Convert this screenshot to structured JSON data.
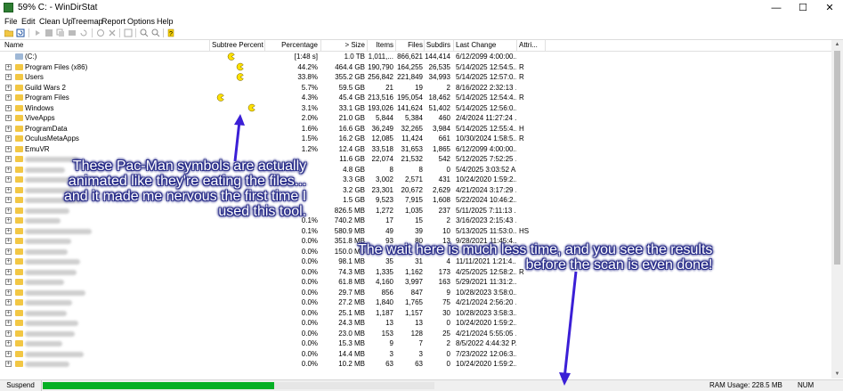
{
  "window": {
    "title": "59% C: - WinDirStat",
    "minimize": "—",
    "maximize": "☐",
    "close": "✕"
  },
  "menu": [
    "File",
    "Edit",
    "Clean Up",
    "Treemap",
    "Report",
    "Options",
    "Help"
  ],
  "columns": {
    "name": "Name",
    "subtree": "Subtree Percent...",
    "percentage": "Percentage",
    "size": "> Size",
    "items": "Items",
    "files": "Files",
    "subdirs": "Subdirs",
    "last_change": "Last Change",
    "attr": "Attri..."
  },
  "rows": [
    {
      "name": "(C:)",
      "pct": "[1:48 s]",
      "size": "1.0 TB",
      "items": "1,011,...",
      "files": "866,621",
      "subdirs": "144,414",
      "date": "6/12/2099  4:00:00...",
      "attr": "",
      "expand": "",
      "icon": "drive",
      "blur": false
    },
    {
      "name": "Program Files (x86)",
      "pct": "44.2%",
      "size": "464.4 GB",
      "items": "190,790",
      "files": "164,255",
      "subdirs": "26,535",
      "date": "5/14/2025  12:54:5...",
      "attr": "R",
      "expand": "+",
      "icon": "folder",
      "blur": false
    },
    {
      "name": "Users",
      "pct": "33.8%",
      "size": "355.2 GB",
      "items": "256,842",
      "files": "221,849",
      "subdirs": "34,993",
      "date": "5/14/2025  12:57:0...",
      "attr": "R",
      "expand": "+",
      "icon": "folder",
      "blur": false
    },
    {
      "name": "Guild Wars 2",
      "pct": "5.7%",
      "size": "59.5 GB",
      "items": "21",
      "files": "19",
      "subdirs": "2",
      "date": "8/16/2022  2:32:13 ...",
      "attr": "",
      "expand": "+",
      "icon": "folder",
      "blur": false
    },
    {
      "name": "Program Files",
      "pct": "4.3%",
      "size": "45.4 GB",
      "items": "213,516",
      "files": "195,054",
      "subdirs": "18,462",
      "date": "5/14/2025  12:54:4...",
      "attr": "R",
      "expand": "+",
      "icon": "folder",
      "blur": false
    },
    {
      "name": "Windows",
      "pct": "3.1%",
      "size": "33.1 GB",
      "items": "193,026",
      "files": "141,624",
      "subdirs": "51,402",
      "date": "5/14/2025  12:56:0...",
      "attr": "",
      "expand": "+",
      "icon": "folder",
      "blur": false
    },
    {
      "name": "ViveApps",
      "pct": "2.0%",
      "size": "21.0 GB",
      "items": "5,844",
      "files": "5,384",
      "subdirs": "460",
      "date": "2/4/2024  11:27:24 ...",
      "attr": "",
      "expand": "+",
      "icon": "folder",
      "blur": false
    },
    {
      "name": "ProgramData",
      "pct": "1.6%",
      "size": "16.6 GB",
      "items": "36,249",
      "files": "32,265",
      "subdirs": "3,984",
      "date": "5/14/2025  12:55:4...",
      "attr": "H",
      "expand": "+",
      "icon": "folder",
      "blur": false
    },
    {
      "name": "OculusMetaApps",
      "pct": "1.5%",
      "size": "16.2 GB",
      "items": "12,085",
      "files": "11,424",
      "subdirs": "661",
      "date": "10/30/2024  1:58:5...",
      "attr": "R",
      "expand": "+",
      "icon": "folder",
      "blur": false
    },
    {
      "name": "EmuVR",
      "pct": "1.2%",
      "size": "12.4 GB",
      "items": "33,518",
      "files": "31,653",
      "subdirs": "1,865",
      "date": "6/12/2099  4:00:00...",
      "attr": "",
      "expand": "+",
      "icon": "folder",
      "blur": false
    },
    {
      "name": "",
      "pct": "",
      "size": "11.6 GB",
      "items": "22,074",
      "files": "21,532",
      "subdirs": "542",
      "date": "5/12/2025  7:52:25 ...",
      "attr": "",
      "expand": "+",
      "icon": "folder",
      "blur": true,
      "bw": 60
    },
    {
      "name": "",
      "pct": "",
      "size": "4.8 GB",
      "items": "8",
      "files": "8",
      "subdirs": "0",
      "date": "5/4/2025  3:03:52 A...",
      "attr": "",
      "expand": "+",
      "icon": "folder",
      "blur": true,
      "bw": 45
    },
    {
      "name": "",
      "pct": "",
      "size": "3.3 GB",
      "items": "3,002",
      "files": "2,571",
      "subdirs": "431",
      "date": "10/24/2020  1:59:2...",
      "attr": "",
      "expand": "+",
      "icon": "folder",
      "blur": true,
      "bw": 70
    },
    {
      "name": "",
      "pct": "",
      "size": "3.2 GB",
      "items": "23,301",
      "files": "20,672",
      "subdirs": "2,629",
      "date": "4/21/2024  3:17:29 ...",
      "attr": "",
      "expand": "+",
      "icon": "folder",
      "blur": true,
      "bw": 55
    },
    {
      "name": "",
      "pct": "",
      "size": "1.5 GB",
      "items": "9,523",
      "files": "7,915",
      "subdirs": "1,608",
      "date": "5/22/2024  10:46:2...",
      "attr": "",
      "expand": "+",
      "icon": "folder",
      "blur": true,
      "bw": 65
    },
    {
      "name": "",
      "pct": "",
      "size": "826.5 MB",
      "items": "1,272",
      "files": "1,035",
      "subdirs": "237",
      "date": "5/11/2025  7:11:13 ...",
      "attr": "",
      "expand": "+",
      "icon": "folder",
      "blur": true,
      "bw": 50
    },
    {
      "name": "",
      "pct": "0.1%",
      "size": "740.2 MB",
      "items": "17",
      "files": "15",
      "subdirs": "2",
      "date": "3/16/2023  2:15:43 ...",
      "attr": "",
      "expand": "+",
      "icon": "folder",
      "blur": true,
      "bw": 40
    },
    {
      "name": "",
      "pct": "0.1%",
      "size": "580.9 MB",
      "items": "49",
      "files": "39",
      "subdirs": "10",
      "date": "5/13/2025  11:53:0...",
      "attr": "HS",
      "expand": "+",
      "icon": "folder",
      "blur": true,
      "bw": 75
    },
    {
      "name": "",
      "pct": "0.0%",
      "size": "351.8 MB",
      "items": "93",
      "files": "80",
      "subdirs": "13",
      "date": "9/28/2021  11:45:4...",
      "attr": "",
      "expand": "+",
      "icon": "folder",
      "blur": true,
      "bw": 52
    },
    {
      "name": "",
      "pct": "0.0%",
      "size": "150.0 MB",
      "items": "",
      "files": "",
      "subdirs": "",
      "date": "",
      "attr": "",
      "expand": "+",
      "icon": "folder",
      "blur": true,
      "bw": 48
    },
    {
      "name": "",
      "pct": "0.0%",
      "size": "98.1 MB",
      "items": "35",
      "files": "31",
      "subdirs": "4",
      "date": "11/11/2021  1:21:4...",
      "attr": "",
      "expand": "+",
      "icon": "folder",
      "blur": true,
      "bw": 62
    },
    {
      "name": "",
      "pct": "0.0%",
      "size": "74.3 MB",
      "items": "1,335",
      "files": "1,162",
      "subdirs": "173",
      "date": "4/25/2025  12:58:2...",
      "attr": "R",
      "expand": "+",
      "icon": "folder",
      "blur": true,
      "bw": 58
    },
    {
      "name": "",
      "pct": "0.0%",
      "size": "61.8 MB",
      "items": "4,160",
      "files": "3,997",
      "subdirs": "163",
      "date": "5/29/2021  11:31:2...",
      "attr": "",
      "expand": "+",
      "icon": "folder",
      "blur": true,
      "bw": 44
    },
    {
      "name": "",
      "pct": "0.0%",
      "size": "29.7 MB",
      "items": "856",
      "files": "847",
      "subdirs": "9",
      "date": "10/28/2023  3:58:0...",
      "attr": "",
      "expand": "+",
      "icon": "folder",
      "blur": true,
      "bw": 68
    },
    {
      "name": "",
      "pct": "0.0%",
      "size": "27.2 MB",
      "items": "1,840",
      "files": "1,765",
      "subdirs": "75",
      "date": "4/21/2024  2:56:20 ...",
      "attr": "",
      "expand": "+",
      "icon": "folder",
      "blur": true,
      "bw": 53
    },
    {
      "name": "",
      "pct": "0.0%",
      "size": "25.1 MB",
      "items": "1,187",
      "files": "1,157",
      "subdirs": "30",
      "date": "10/28/2023  3:58:3...",
      "attr": "",
      "expand": "+",
      "icon": "folder",
      "blur": true,
      "bw": 47
    },
    {
      "name": "",
      "pct": "0.0%",
      "size": "24.3 MB",
      "items": "13",
      "files": "13",
      "subdirs": "0",
      "date": "10/24/2020  1:59:2...",
      "attr": "",
      "expand": "+",
      "icon": "folder",
      "blur": true,
      "bw": 60
    },
    {
      "name": "",
      "pct": "0.0%",
      "size": "23.0 MB",
      "items": "153",
      "files": "128",
      "subdirs": "25",
      "date": "4/21/2024  5:55:05 ...",
      "attr": "",
      "expand": "+",
      "icon": "folder",
      "blur": true,
      "bw": 56
    },
    {
      "name": "",
      "pct": "0.0%",
      "size": "15.3 MB",
      "items": "9",
      "files": "7",
      "subdirs": "2",
      "date": "8/5/2022  4:44:32 P...",
      "attr": "",
      "expand": "+",
      "icon": "folder",
      "blur": true,
      "bw": 42
    },
    {
      "name": "",
      "pct": "0.0%",
      "size": "14.4 MB",
      "items": "3",
      "files": "3",
      "subdirs": "0",
      "date": "7/23/2022  12:06:3...",
      "attr": "",
      "expand": "+",
      "icon": "folder",
      "blur": true,
      "bw": 66
    },
    {
      "name": "",
      "pct": "0.0%",
      "size": "10.2 MB",
      "items": "63",
      "files": "63",
      "subdirs": "0",
      "date": "10/24/2020  1:59:2...",
      "attr": "",
      "expand": "+",
      "icon": "folder",
      "blur": true,
      "bw": 50
    }
  ],
  "pacman_row_indices": [
    0,
    1,
    2,
    4,
    5
  ],
  "status": {
    "suspend": "Suspend",
    "progress_fraction": 0.59,
    "ram": "RAM Usage:   228.5 MB",
    "num": "NUM"
  },
  "annotations": {
    "left": "These Pac-Man symbols are actually\nanimated like they're eating the files...\nand it made me nervous the first time I\nused this tool.",
    "right": "The wait here is much less time, and you see the results\nbefore the scan is even done!"
  },
  "colors": {
    "pacman": "#ffe100",
    "arrow": "#3b1fd6",
    "progress": "#06b025",
    "folder": "#f2c744"
  }
}
